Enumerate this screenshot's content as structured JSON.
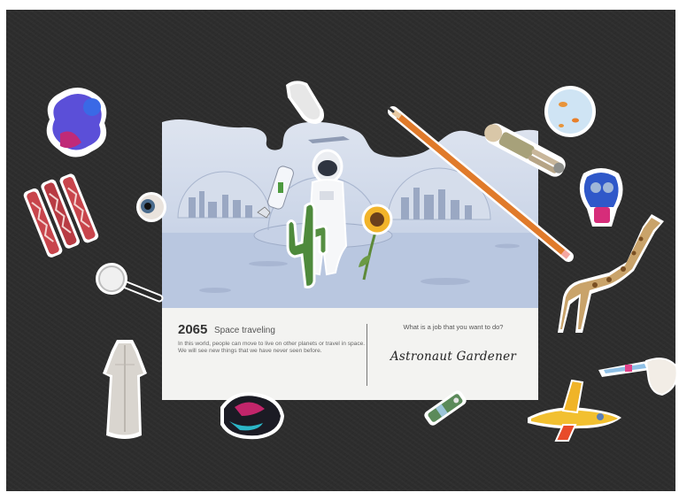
{
  "card": {
    "year": "2065",
    "title": "Space traveling",
    "description": "In this world, people can move to live on other planets or travel in space. We will see new things that we have never seen before.",
    "question": "What is a job that you want to do?",
    "answer": "Astronaut Gardener"
  },
  "stickers": [
    "paint-splash",
    "bacon",
    "eyeball",
    "magnifying-glass",
    "dress",
    "glove",
    "fish-bowl",
    "doll",
    "gas-mask",
    "giraffe",
    "syringe",
    "toy-plane",
    "abstract-blob",
    "battery-toy",
    "pencil"
  ],
  "colors": {
    "board": "#2d2d2d",
    "card": "#f3f3f1",
    "scene": "#c8d3e6",
    "pencil": "#e07a2a"
  }
}
